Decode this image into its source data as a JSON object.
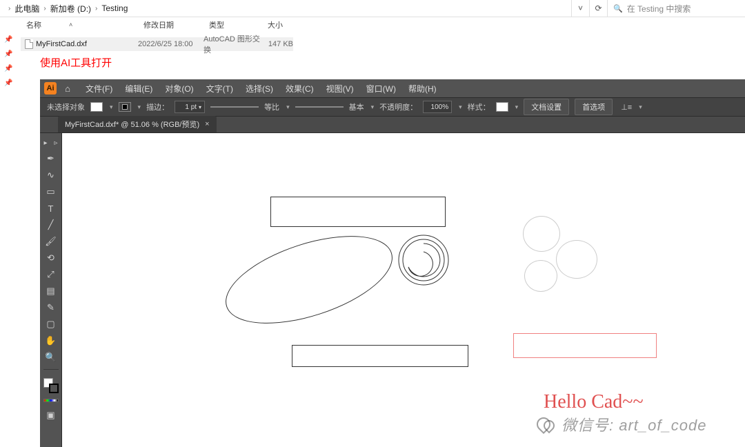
{
  "explorer": {
    "breadcrumb": [
      "此电脑",
      "新加卷 (D:)",
      "Testing"
    ],
    "refresh_glyph": "⟳",
    "dropdown_glyph": "˅",
    "search_placeholder": "在 Testing 中搜索",
    "columns": {
      "name": "名称",
      "date": "修改日期",
      "type": "类型",
      "size": "大小"
    },
    "file": {
      "name": "MyFirstCad.dxf",
      "date": "2022/6/25 18:00",
      "type": "AutoCAD 图形交换",
      "size": "147 KB"
    }
  },
  "annotation": "使用AI工具打开",
  "ai": {
    "logo_text": "Ai",
    "menus": {
      "file": "文件(F)",
      "edit": "编辑(E)",
      "object": "对象(O)",
      "type": "文字(T)",
      "select": "选择(S)",
      "effect": "效果(C)",
      "view": "视图(V)",
      "window": "窗口(W)",
      "help": "帮助(H)"
    },
    "controlbar": {
      "no_selection": "未选择对象",
      "stroke_label": "描边：",
      "stroke_pt": "1 pt",
      "uniform": "等比",
      "basic": "基本",
      "opacity_label": "不透明度：",
      "opacity_value": "100%",
      "style_label": "样式：",
      "doc_setup": "文档设置",
      "prefs": "首选项"
    },
    "doc_tab": "MyFirstCad.dxf* @ 51.06 % (RGB/预览)",
    "tools": {
      "selection": "▸",
      "direct": "▹",
      "pen": "✒",
      "curvature": "∿",
      "rect": "▭",
      "type": "T",
      "line": "╱",
      "brush": "🖌",
      "rotate": "⟲",
      "scale": "⤢",
      "gradient": "▤",
      "eyedropper": "✎",
      "artboard": "▢",
      "hand": "✋",
      "zoom": "🔍"
    },
    "canvas_text": "Hello Cad~~"
  },
  "watermark": "微信号: art_of_code"
}
